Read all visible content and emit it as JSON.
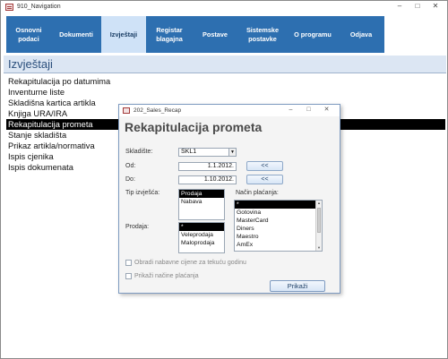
{
  "window": {
    "title": "910_Navigation",
    "controls": [
      "–",
      "□",
      "✕"
    ]
  },
  "nav": {
    "items": [
      {
        "label": "Osnovni\npodaci",
        "w": 50
      },
      {
        "label": "Dokumenti",
        "w": 56
      },
      {
        "label": "Izvještaji",
        "w": 50,
        "active": true
      },
      {
        "label": "Registar\nblagajna",
        "w": 52
      },
      {
        "label": "Postave",
        "w": 50
      },
      {
        "label": "Sistemske\npostavke",
        "w": 56
      },
      {
        "label": "O programu",
        "w": 56
      },
      {
        "label": "Odjava",
        "w": 52
      }
    ]
  },
  "section": {
    "title": "Izvještaji"
  },
  "reports": [
    {
      "label": "Rekapitulacija po datumima"
    },
    {
      "label": "Inventurne liste"
    },
    {
      "label": "Skladišna kartica artikla"
    },
    {
      "label": "Knjiga URA/IRA"
    },
    {
      "label": "Rekapitulacija prometa",
      "selected": true
    },
    {
      "label": "Stanje skladišta"
    },
    {
      "label": "Prikaz artikla/normativa"
    },
    {
      "label": "Ispis cjenika"
    },
    {
      "label": "Ispis dokumenata"
    }
  ],
  "dialog": {
    "title": "202_Sales_Recap",
    "controls": [
      "–",
      "□",
      "✕"
    ],
    "heading": "Rekapitulacija prometa",
    "skladiste_label": "Skladište:",
    "skladiste_value": "SKL1",
    "od_label": "Od:",
    "od_value": "1.1.2012.",
    "do_label": "Do:",
    "do_value": "1.10.2012.",
    "back_label": "<<",
    "tip_label": "Tip izvješća:",
    "tip_options": [
      {
        "label": "Prodaja",
        "selected": true
      },
      {
        "label": "Nabava"
      }
    ],
    "nacin_label": "Način plaćanja:",
    "nacin_options": [
      {
        "label": "*",
        "selected": true
      },
      {
        "label": "Gotovina"
      },
      {
        "label": "MasterCard"
      },
      {
        "label": "Diners"
      },
      {
        "label": "Maestro"
      },
      {
        "label": "AmEx"
      }
    ],
    "prodaja_label": "Prodaja:",
    "prodaja_options": [
      {
        "label": "*",
        "selected": true
      },
      {
        "label": "Veleprodaja"
      },
      {
        "label": "Maloprodaja"
      }
    ],
    "chk_obradi": "Obradi nabavne cijene za tekuću godinu",
    "chk_prikazi": "Prikaži načine plaćanja",
    "prikazi_button": "Prikaži"
  }
}
